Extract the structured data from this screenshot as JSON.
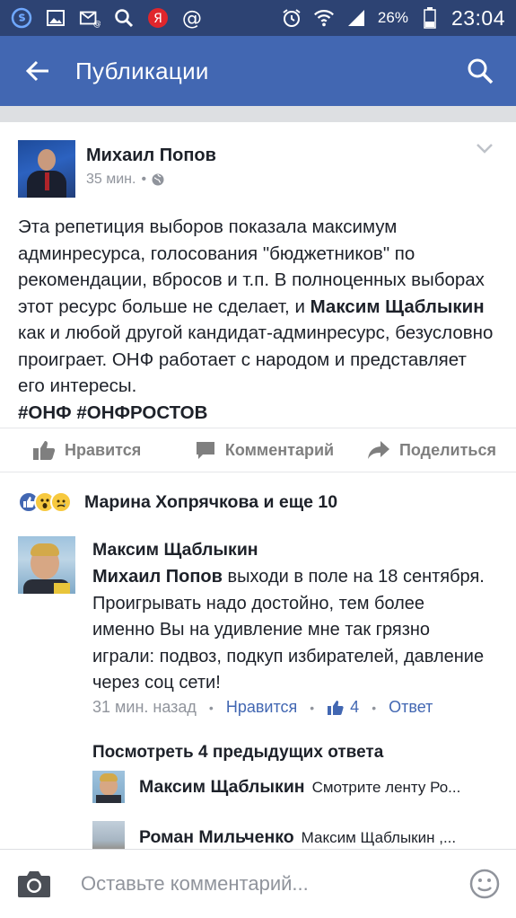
{
  "status_bar": {
    "battery_percent": "26%",
    "time": "23:04",
    "icons": [
      "skype-icon",
      "gallery-icon",
      "mail-icon",
      "search-icon",
      "yandex-icon",
      "at-icon",
      "alarm-icon",
      "wifi-icon",
      "signal-icon",
      "battery-icon"
    ],
    "yandex_letter": "Я"
  },
  "app_bar": {
    "title": "Публикации",
    "background": "#4267b2"
  },
  "post": {
    "author": "Михаил Попов",
    "time": "35 мин.",
    "time_separator": "•",
    "text_part1": "Эта репетиция выборов показала максимум админресурса, голосования \"бюджетников\" по рекомендации, вбросов и т.п. В полноценных выборах этот ресурс больше не сделает, и ",
    "text_mention": "Максим Щаблыкин",
    "text_part2": " как и любой другой кандидат-админресурс, безусловно проиграет. ОНФ работает с народом и представляет его интересы.",
    "hashtags": "#ОНФ #ОНФРОСТОВ",
    "actions": {
      "like": "Нравится",
      "comment": "Комментарий",
      "share": "Поделиться"
    }
  },
  "reactions": {
    "text": "Марина Хопрячкова и еще 10",
    "types": [
      "like",
      "wow",
      "sad"
    ]
  },
  "comment": {
    "author": "Максим Щаблыкин",
    "mention": "Михаил Попов",
    "text": " выходи в поле на  18 сентября. Проигрывать надо достойно, тем более именно Вы на удивление мне так грязно играли: подвоз, подкуп избирателей, давление через соц сети!",
    "time": "31 мин. назад",
    "like_label": "Нравится",
    "like_count": "4",
    "reply_label": "Ответ",
    "separator": "•"
  },
  "previous_replies_label": "Посмотреть 4 предыдущих ответа",
  "replies": [
    {
      "author": "Максим Щаблыкин",
      "snippet": "Смотрите ленту Ро..."
    },
    {
      "author": "Роман Мильченко",
      "snippet": "Максим Щаблыкин ,..."
    }
  ],
  "composer": {
    "placeholder": "Оставьте комментарий..."
  },
  "colors": {
    "status_bar": "#2d4373",
    "accent": "#4267b2",
    "muted_text": "#90949c"
  }
}
